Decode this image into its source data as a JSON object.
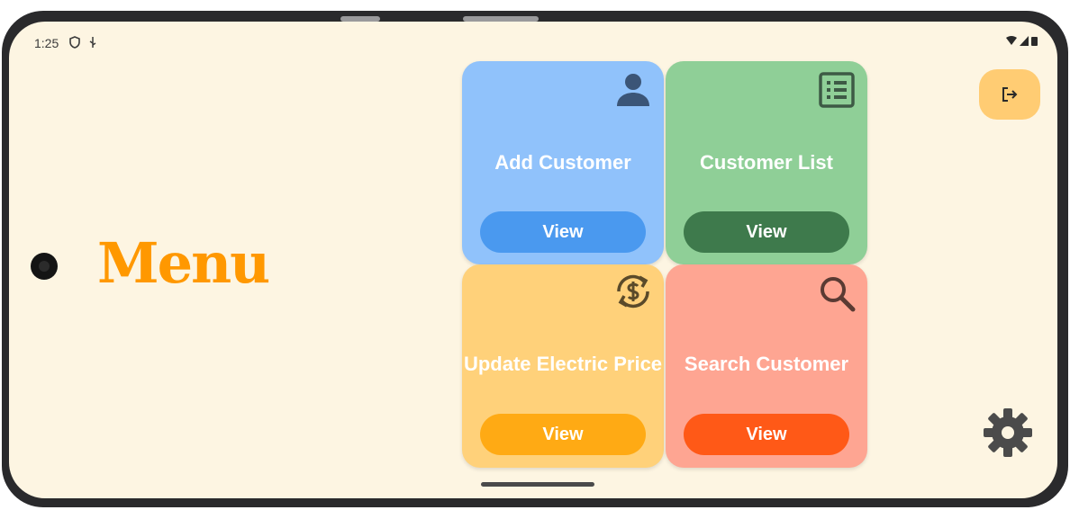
{
  "status_bar": {
    "time": "1:25"
  },
  "menu": {
    "title": "Menu"
  },
  "cards": [
    {
      "label": "Add Customer",
      "button": "View",
      "icon": "person-icon",
      "color": "#90c2fb",
      "button_color": "#4a99ef"
    },
    {
      "label": "Customer List",
      "button": "View",
      "icon": "list-icon",
      "color": "#8fcf97",
      "button_color": "#3e7a4c"
    },
    {
      "label": "Update Electric Price",
      "button": "View",
      "icon": "currency-exchange-icon",
      "color": "#ffd17a",
      "button_color": "#ffaa14"
    },
    {
      "label": "Search Customer",
      "button": "View",
      "icon": "search-icon",
      "color": "#fea592",
      "button_color": "#ff5917"
    }
  ],
  "actions": {
    "logout_icon": "logout-icon",
    "settings_icon": "gear-icon"
  }
}
